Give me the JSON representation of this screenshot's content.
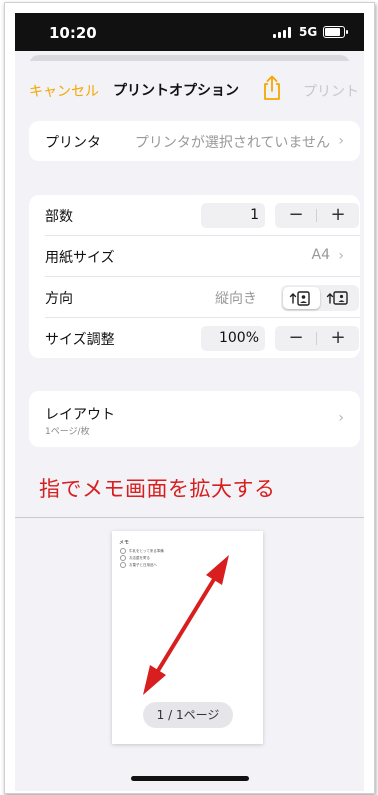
{
  "status_bar": {
    "time": "10:20",
    "network": "5G"
  },
  "nav": {
    "cancel": "キャンセル",
    "title": "プリントオプション",
    "print": "プリント"
  },
  "printer": {
    "label": "プリンタ",
    "value": "プリンタが選択されていません"
  },
  "settings": {
    "copies": {
      "label": "部数",
      "value": "1"
    },
    "paper_size": {
      "label": "用紙サイズ",
      "value": "A4"
    },
    "orientation": {
      "label": "方向",
      "value": "縦向き"
    },
    "scaling": {
      "label": "サイズ調整",
      "value": "100%"
    }
  },
  "stepper": {
    "minus": "−",
    "plus": "+"
  },
  "layout": {
    "label": "レイアウト",
    "sub": "1ページ/枚"
  },
  "annotation": "指でメモ画面を拡大する",
  "preview": {
    "page_title": "メモ",
    "items": [
      "牛乳をとって来る準備",
      "お店屋を寄る",
      "お菓子と日用品へ"
    ],
    "page_count": "1 / 1ページ"
  },
  "colors": {
    "accent": "#f2a900",
    "annotation": "#d81e1e",
    "disabled": "#c8c8cc"
  }
}
